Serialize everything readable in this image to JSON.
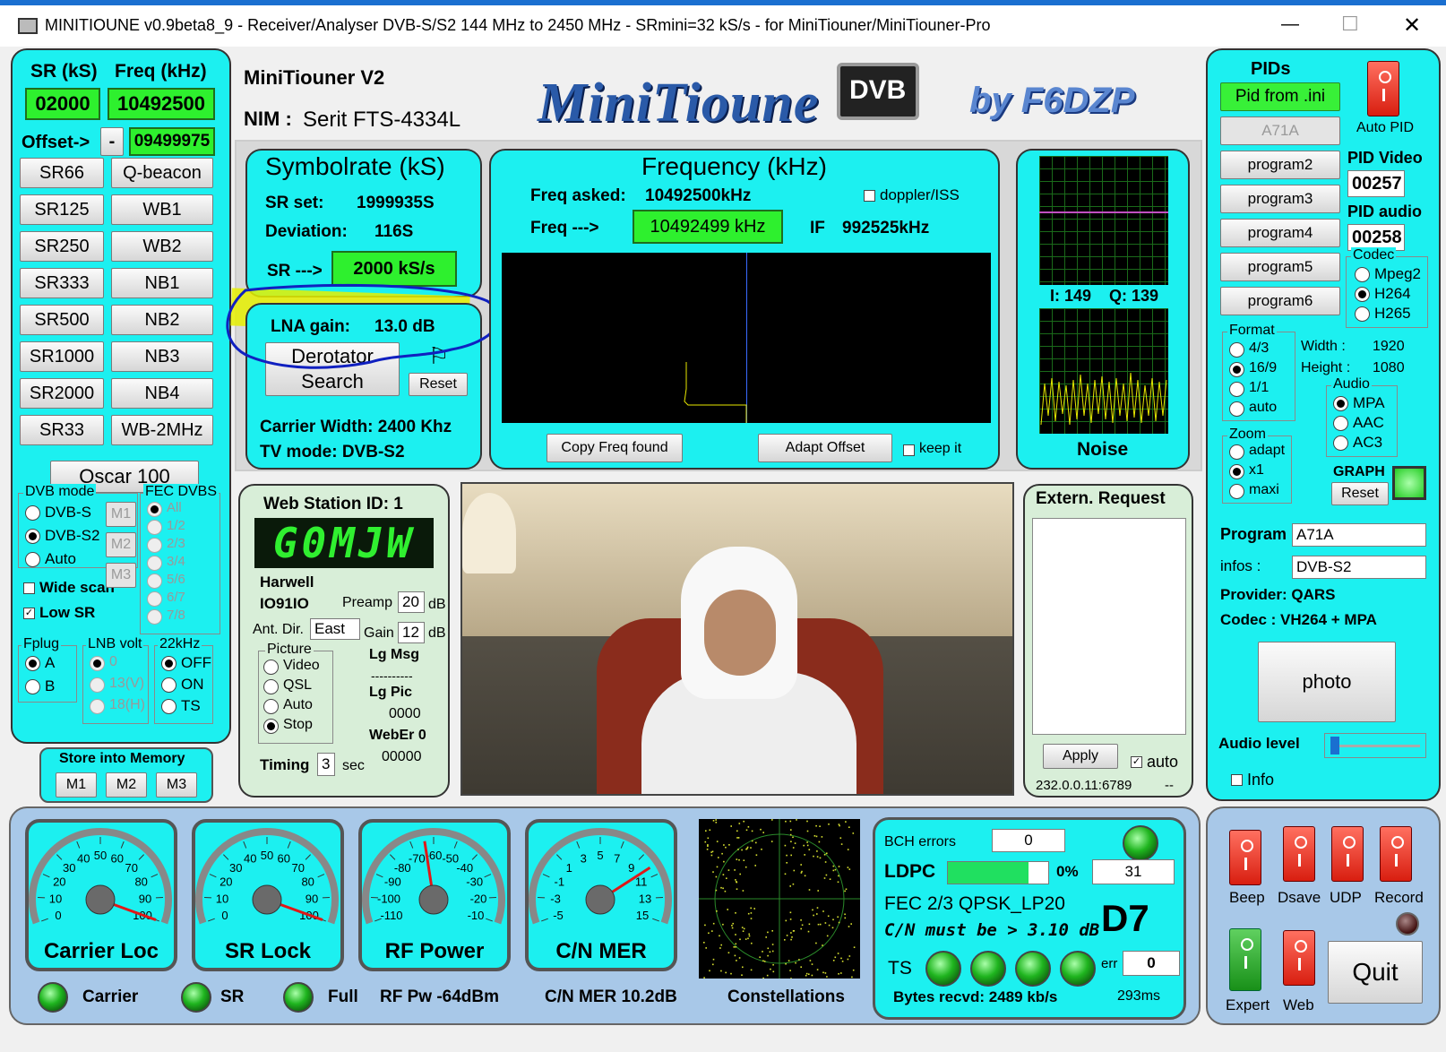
{
  "window": {
    "title": "MINITIOUNE v0.9beta8_9 - Receiver/Analyser DVB-S/S2 144 MHz to 2450 MHz - SRmini=32 kS/s - for MiniTiouner/MiniTiouner-Pro",
    "minimize": "—",
    "maximize": "☐",
    "close": "✕"
  },
  "header": {
    "device": "MiniTiouner V2",
    "nim_label": "NIM :",
    "nim_value": "Serit FTS-4334L",
    "logo_text": "MiniTioune",
    "logo_badge": "DVB",
    "byline": "by F6DZP"
  },
  "left": {
    "sr_label": "SR (kS)",
    "freq_label": "Freq (kHz)",
    "sr_value": "02000",
    "freq_value": "10492500",
    "offset_label": "Offset->",
    "offset_sign": "-",
    "offset_value": "09499975",
    "sr_buttons": [
      "SR66",
      "SR125",
      "SR250",
      "SR333",
      "SR500",
      "SR1000",
      "SR2000",
      "SR33"
    ],
    "band_buttons": [
      "Q-beacon",
      "WB1",
      "WB2",
      "NB1",
      "NB2",
      "NB3",
      "NB4",
      "WB-2MHz"
    ],
    "oscar": "Oscar 100",
    "dvb_mode": {
      "label": "DVB mode",
      "options": [
        "DVB-S",
        "DVB-S2",
        "Auto"
      ],
      "selected": 1
    },
    "mem_small": [
      "M1",
      "M2",
      "M3"
    ],
    "fec": {
      "label": "FEC DVBS",
      "options": [
        "All",
        "1/2",
        "2/3",
        "3/4",
        "5/6",
        "6/7",
        "7/8"
      ]
    },
    "wide_scan": "Wide scan",
    "low_sr": "Low SR",
    "check_mark": "✓",
    "fplug": {
      "label": "Fplug",
      "options": [
        "A",
        "B"
      ]
    },
    "lnb": {
      "label": "LNB volt",
      "options": [
        "0",
        "13(V)",
        "18(H)"
      ]
    },
    "khz22": {
      "label": "22kHz",
      "options": [
        "OFF",
        "ON",
        "TS"
      ]
    },
    "store": {
      "label": "Store into Memory",
      "buttons": [
        "M1",
        "M2",
        "M3"
      ]
    }
  },
  "symbolrate": {
    "title": "Symbolrate (kS)",
    "sr_set_label": "SR set:",
    "sr_set": "1999935S",
    "deviation_label": "Deviation:",
    "deviation": "116S",
    "sr_arrow": "SR --->",
    "sr_value": "2000 kS/s"
  },
  "lna": {
    "label": "LNA gain:",
    "value": "13.0 dB",
    "derotator": "Derotator",
    "search": "Search",
    "reset": "Reset",
    "carrier_width": "Carrier Width: 2400 Khz",
    "tv_mode": "TV mode:  DVB-S2"
  },
  "frequency": {
    "title": "Frequency (kHz)",
    "asked_label": "Freq asked:",
    "asked": "10492500kHz",
    "doppler": "doppler/ISS",
    "freq_arrow": "Freq --->",
    "freq_value": "10492499 kHz",
    "if_label": "IF",
    "if_value": "992525kHz",
    "copy_btn": "Copy Freq found",
    "adapt_btn": "Adapt Offset",
    "keep": "keep it"
  },
  "iq": {
    "i": "I:  149",
    "q": "Q: 139",
    "noise": "Noise"
  },
  "pids": {
    "title": "PIDs",
    "from_ini": "Pid from .ini",
    "a71a": "A71A",
    "programs": [
      "program2",
      "program3",
      "program4",
      "program5",
      "program6"
    ],
    "auto_pid": "Auto PID",
    "pid_video_label": "PID Video",
    "pid_video": "00257",
    "pid_audio_label": "PID audio",
    "pid_audio": "00258",
    "codec": {
      "label": "Codec",
      "options": [
        "Mpeg2",
        "H264",
        "H265"
      ],
      "selected": 1
    },
    "format": {
      "label": "Format",
      "options": [
        "4/3",
        "16/9",
        "1/1",
        "auto"
      ],
      "selected": 1
    },
    "width_label": "Width :",
    "width": "1920",
    "height_label": "Height :",
    "height": "1080",
    "audio": {
      "label": "Audio",
      "options": [
        "MPA",
        "AAC",
        "AC3"
      ],
      "selected": 0
    },
    "zoom": {
      "label": "Zoom",
      "options": [
        "adapt",
        "x1",
        "maxi"
      ],
      "selected": 1
    },
    "graph": "GRAPH",
    "graph_reset": "Reset",
    "program_label": "Program",
    "program": "A71A",
    "infos_label": "infos :",
    "infos": "DVB-S2",
    "provider": "Provider: QARS",
    "codec_info": "Codec :    VH264 + MPA",
    "photo": "photo",
    "audio_level": "Audio level",
    "info": "Info"
  },
  "web": {
    "title": "Web Station ID:  1",
    "callsign": "G0MJW",
    "location": "Harwell",
    "locator": "IO91IO",
    "preamp_label": "Preamp",
    "preamp": "20",
    "db1": "dB",
    "ant_label": "Ant. Dir.",
    "ant": "East",
    "gain_label": "Gain",
    "gain": "12",
    "db2": "dB",
    "picture": {
      "label": "Picture",
      "options": [
        "Video",
        "QSL",
        "Auto",
        "Stop"
      ],
      "selected": 3
    },
    "lg_msg": "Lg Msg",
    "lg_msg_val": "----------",
    "lg_pic": "Lg Pic",
    "lg_pic_val": "0000",
    "weber": "WebEr 0",
    "weber_val": "00000",
    "timing": "Timing",
    "timing_val": "3",
    "sec": "sec"
  },
  "extern": {
    "title": "Extern. Request",
    "apply": "Apply",
    "auto": "auto",
    "address": "232.0.0.11:6789",
    "dashes": "--"
  },
  "gauges": [
    {
      "label": "Carrier Loc",
      "ticks": [
        "0",
        "10",
        "20",
        "30",
        "40",
        "50",
        "60",
        "70",
        "80",
        "90",
        "100"
      ],
      "value": 100,
      "min": 0,
      "max": 100
    },
    {
      "label": "SR Lock",
      "ticks": [
        "0",
        "10",
        "20",
        "30",
        "40",
        "50",
        "60",
        "70",
        "80",
        "90",
        "100"
      ],
      "value": 100,
      "min": 0,
      "max": 100
    },
    {
      "label": "RF Power",
      "ticks": [
        "-110",
        "-100",
        "-90",
        "-80",
        "-70",
        "-60",
        "-50",
        "-40",
        "-30",
        "-20",
        "-10"
      ],
      "value": -64,
      "min": -110,
      "max": -10
    },
    {
      "label": "C/N MER",
      "ticks": [
        "-5",
        "-3",
        "-1",
        "1",
        "3",
        "5",
        "7",
        "9",
        "11",
        "13",
        "15"
      ],
      "value": 10.2,
      "min": -5,
      "max": 15
    }
  ],
  "status": {
    "carrier": "Carrier",
    "sr": "SR",
    "full": "Full",
    "rf_pw": "RF Pw  -64dBm",
    "cn_mer": "C/N MER  10.2dB",
    "constellations": "Constellations"
  },
  "decoder": {
    "bch_label": "BCH errors",
    "bch": "0",
    "ldpc_label": "LDPC",
    "ldpc_pct": "0%",
    "ldpc_fill": 0.8,
    "ldpc_val": "31",
    "fec": "FEC  2/3 QPSK_LP20",
    "cn_must": "C/N must be > 3.10 dB",
    "d_level": "D7",
    "ts": "TS",
    "err_label": "err",
    "err": "0",
    "bytes": "Bytes recvd:  2489 kb/s",
    "ms": "293ms"
  },
  "controls": {
    "beep": "Beep",
    "dsave": "Dsave",
    "udp": "UDP",
    "record": "Record",
    "expert": "Expert",
    "web": "Web",
    "quit": "Quit"
  },
  "colors": {
    "panel": "#1cf0f0",
    "green_field": "#2ef02e",
    "annotation_blue": "#1020c0",
    "highlight": "#e6f000"
  }
}
